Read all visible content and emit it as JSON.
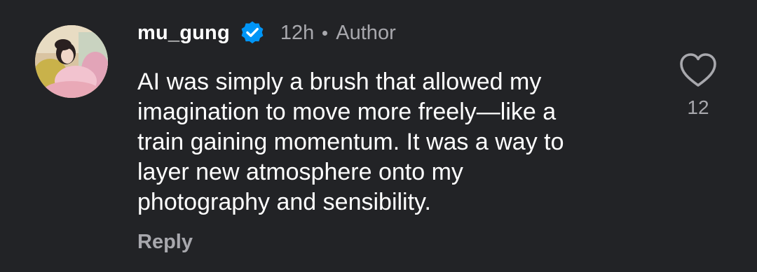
{
  "comment": {
    "username": "mu_gung",
    "verified_icon": "verified-badge-icon",
    "time": "12h",
    "role": "Author",
    "lines": [
      "AI was simply a brush that allowed my",
      "imagination to move more freely—like a",
      "train gaining momentum. It was a way to",
      "layer new atmosphere onto my",
      "photography and sensibility."
    ],
    "reply_label": "Reply",
    "like_icon": "heart-outline-icon",
    "like_count": "12"
  },
  "colors": {
    "background": "#222326",
    "text_primary": "#ffffff",
    "text_secondary": "#a8a8ad",
    "verified_blue": "#0095f6"
  }
}
